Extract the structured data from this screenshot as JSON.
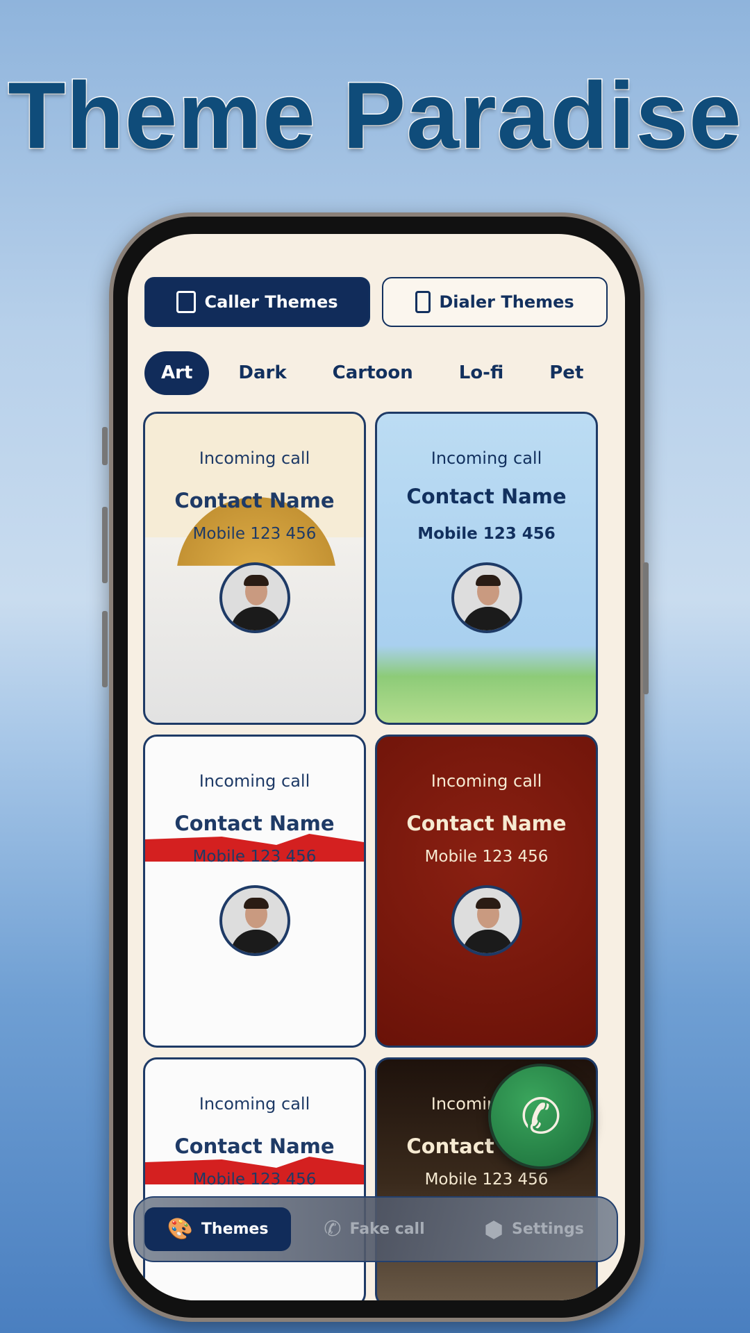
{
  "headline": "Theme Paradise",
  "segments": [
    {
      "label": "Caller Themes",
      "icon": "image-stack-icon",
      "active": true
    },
    {
      "label": "Dialer Themes",
      "icon": "phone-portrait-icon",
      "active": false
    }
  ],
  "categories": [
    {
      "label": "Art",
      "active": true
    },
    {
      "label": "Dark"
    },
    {
      "label": "Cartoon"
    },
    {
      "label": "Lo-fi"
    },
    {
      "label": "Pet"
    }
  ],
  "cards": [
    {
      "incoming": "Incoming call",
      "name": "Contact Name",
      "mobile": "Mobile 123 456",
      "theme": "golden sun"
    },
    {
      "incoming": "Incoming call",
      "name": "Contact Name",
      "mobile": "Mobile 123 456",
      "theme": "sky clouds"
    },
    {
      "incoming": "Incoming call",
      "name": "Contact Name",
      "mobile": "Mobile 123 456",
      "theme": "red roofs"
    },
    {
      "incoming": "Incoming call",
      "name": "Contact Name",
      "mobile": "Mobile 123 456",
      "theme": "red lanterns"
    },
    {
      "incoming": "Incoming call",
      "name": "Contact Name",
      "mobile": "Mobile 123 456",
      "theme": "red roofs"
    },
    {
      "incoming": "Incoming call",
      "name": "Contact Name",
      "mobile": "Mobile 123 456",
      "theme": "dark gold"
    }
  ],
  "nav": [
    {
      "label": "Themes",
      "icon": "palette-icon",
      "active": true
    },
    {
      "label": "Fake call",
      "icon": "phone-ringing-icon"
    },
    {
      "label": "Settings",
      "icon": "hexagon-settings-icon"
    }
  ],
  "fab_icon": "phone-icon",
  "colors": {
    "primary": "#112c5a",
    "screen_bg": "#f7efe3",
    "title": "#0f4c7a",
    "call_green": "#2a8a4a"
  }
}
